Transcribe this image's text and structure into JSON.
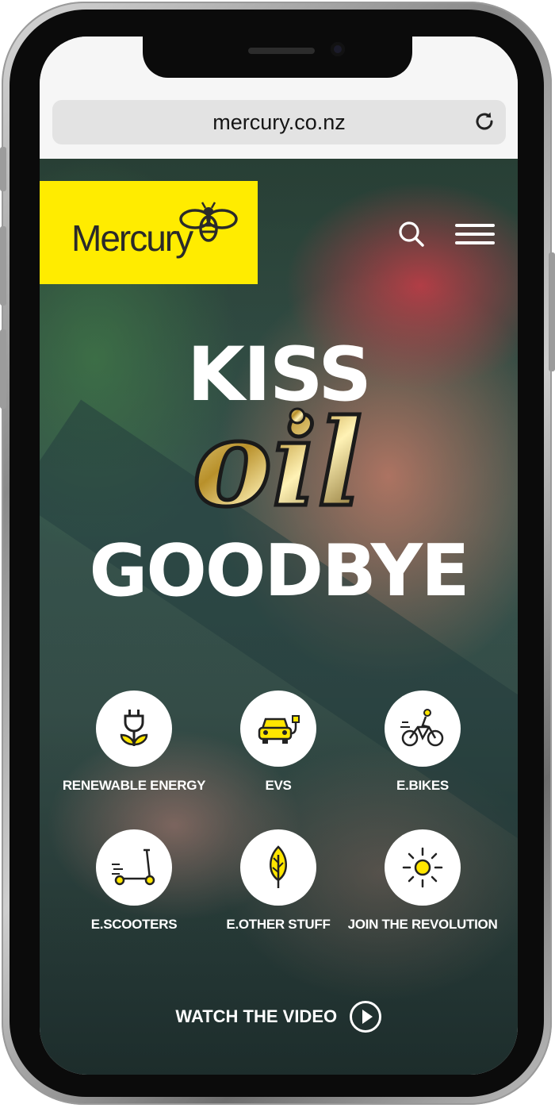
{
  "browser": {
    "url": "mercury.co.nz"
  },
  "header": {
    "logo_text": "Mercury",
    "brand_color": "#ffec00",
    "icons": [
      "search-icon",
      "hamburger-menu-icon"
    ]
  },
  "hero": {
    "headline_top": "KISS",
    "headline_middle": "oil",
    "headline_bottom": "GOODBYE"
  },
  "categories": [
    {
      "label": "RENEWABLE ENERGY",
      "icon": "plug-plant-icon"
    },
    {
      "label": "EVS",
      "icon": "electric-car-icon"
    },
    {
      "label": "E.BIKES",
      "icon": "bicycle-icon"
    },
    {
      "label": "E.SCOOTERS",
      "icon": "scooter-icon"
    },
    {
      "label": "E.OTHER STUFF",
      "icon": "leaf-icon"
    },
    {
      "label": "JOIN THE REVOLUTION",
      "icon": "sun-icon"
    }
  ],
  "video": {
    "label": "WATCH THE VIDEO",
    "icon": "play-icon"
  },
  "colors": {
    "accent_yellow": "#ffe600",
    "text_white": "#ffffff",
    "icon_dark": "#222222"
  }
}
